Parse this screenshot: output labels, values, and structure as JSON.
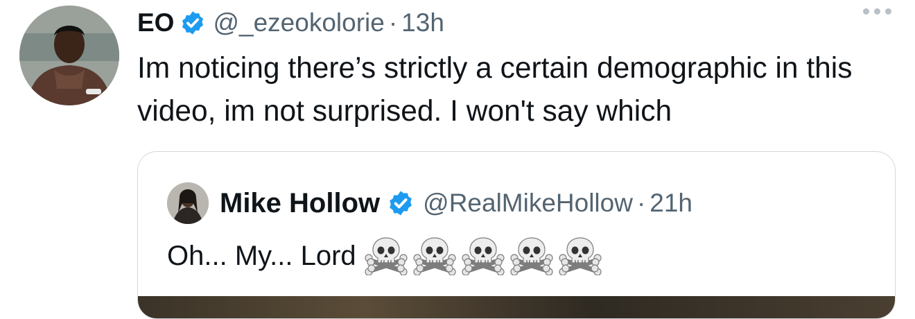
{
  "tweet": {
    "author_name": "EO",
    "handle": "@_ezeokolorie",
    "separator": "·",
    "time": "13h",
    "text": "Im noticing there’s strictly a certain demographic in this video, im not surprised. I won't say which",
    "verified_color": "#1d9bf0"
  },
  "quoted_tweet": {
    "author_name": "Mike Hollow",
    "handle": "@RealMikeHollow",
    "separator": "·",
    "time": "21h",
    "text": "Oh... My... Lord",
    "emoji": [
      "skull-and-crossbones",
      "skull-and-crossbones",
      "skull-and-crossbones",
      "skull-and-crossbones",
      "skull-and-crossbones"
    ]
  },
  "icons": {
    "more": "more-options-icon",
    "verified": "verified-badge-icon"
  },
  "colors": {
    "text_primary": "#0f1419",
    "text_secondary": "#536471",
    "border": "#d3d8dc"
  }
}
